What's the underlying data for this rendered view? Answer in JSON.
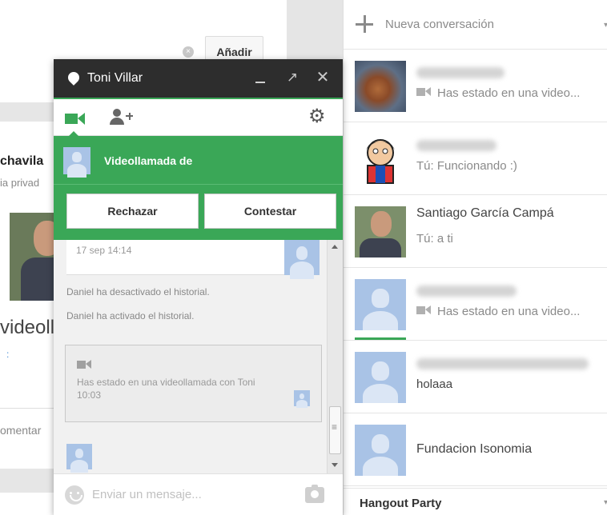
{
  "background": {
    "add_button": "Añadir",
    "profile_name": "chavila",
    "profile_privacy": "ia privad",
    "video_text": "videoll",
    "link_text": ":",
    "comment_text": "omentar"
  },
  "chat": {
    "title": "Toni Villar",
    "incoming_call": "Videollamada de",
    "reject_button": "Rechazar",
    "answer_button": "Contestar",
    "messages": {
      "bubble_time": "17 sep 14:14",
      "history_off": "Daniel ha desactivado el historial.",
      "history_on": "Daniel ha activado el historial.",
      "call_text": "Has estado en una videollamada con Toni",
      "call_time": "10:03"
    },
    "compose_placeholder": "Enviar un mensaje..."
  },
  "list": {
    "new_conversation": "Nueva conversación",
    "conversations": [
      {
        "name": "",
        "snippet": "Has estado en una video..."
      },
      {
        "name": "",
        "snippet": "Tú: Funcionando :)"
      },
      {
        "name": "Santiago García Campá",
        "snippet": "Tú: a ti"
      },
      {
        "name": "",
        "snippet": "Has estado en una video..."
      },
      {
        "name": "",
        "snippet": "holaaa"
      },
      {
        "name": "Fundacion Isonomia",
        "snippet": ""
      }
    ],
    "hangout_party": "Hangout Party"
  },
  "colors": {
    "accent_green": "#3aa757",
    "title_bar": "#2d2d2d",
    "default_avatar": "#a9c3e6"
  },
  "icons": [
    "map-pin-icon",
    "minimize-icon",
    "popout-icon",
    "close-icon",
    "video-camera-icon",
    "add-person-icon",
    "gear-icon",
    "plus-icon",
    "emoji-icon",
    "camera-icon",
    "chevron-down-icon"
  ]
}
